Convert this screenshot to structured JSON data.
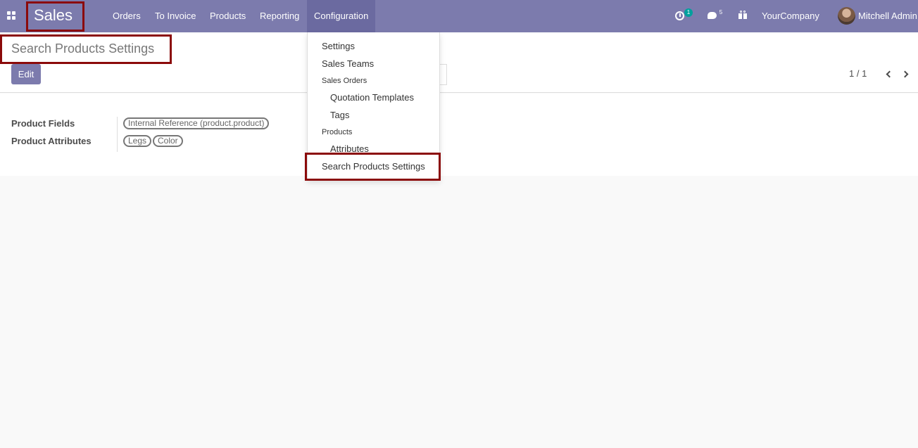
{
  "navbar": {
    "app_name": "Sales",
    "menus": [
      "Orders",
      "To Invoice",
      "Products",
      "Reporting",
      "Configuration"
    ],
    "activity_count": "1",
    "messages_count": "5",
    "company": "YourCompany",
    "user": "Mitchell Admin"
  },
  "breadcrumb": {
    "title": "Search Products Settings"
  },
  "toolbar": {
    "edit_label": "Edit"
  },
  "pager": {
    "text": "1 / 1"
  },
  "form": {
    "fields": [
      {
        "label": "Product Fields",
        "tags": [
          "Internal Reference (product.product)"
        ]
      },
      {
        "label": "Product Attributes",
        "tags": [
          "Legs",
          "Color"
        ]
      }
    ]
  },
  "configuration_menu": {
    "settings": "Settings",
    "sales_teams": "Sales Teams",
    "sales_orders_header": "Sales Orders",
    "quotation_templates": "Quotation Templates",
    "tags": "Tags",
    "products_header": "Products",
    "attributes": "Attributes",
    "search_products_settings": "Search Products Settings"
  },
  "colors": {
    "navbar": "#7c7bad",
    "highlight": "#8b0a0a",
    "badge": "#00a09d"
  },
  "icons": [
    "apps-grid-icon",
    "activity-clock-icon",
    "chat-icon",
    "gift-icon",
    "chevron-left-icon",
    "chevron-right-icon"
  ]
}
